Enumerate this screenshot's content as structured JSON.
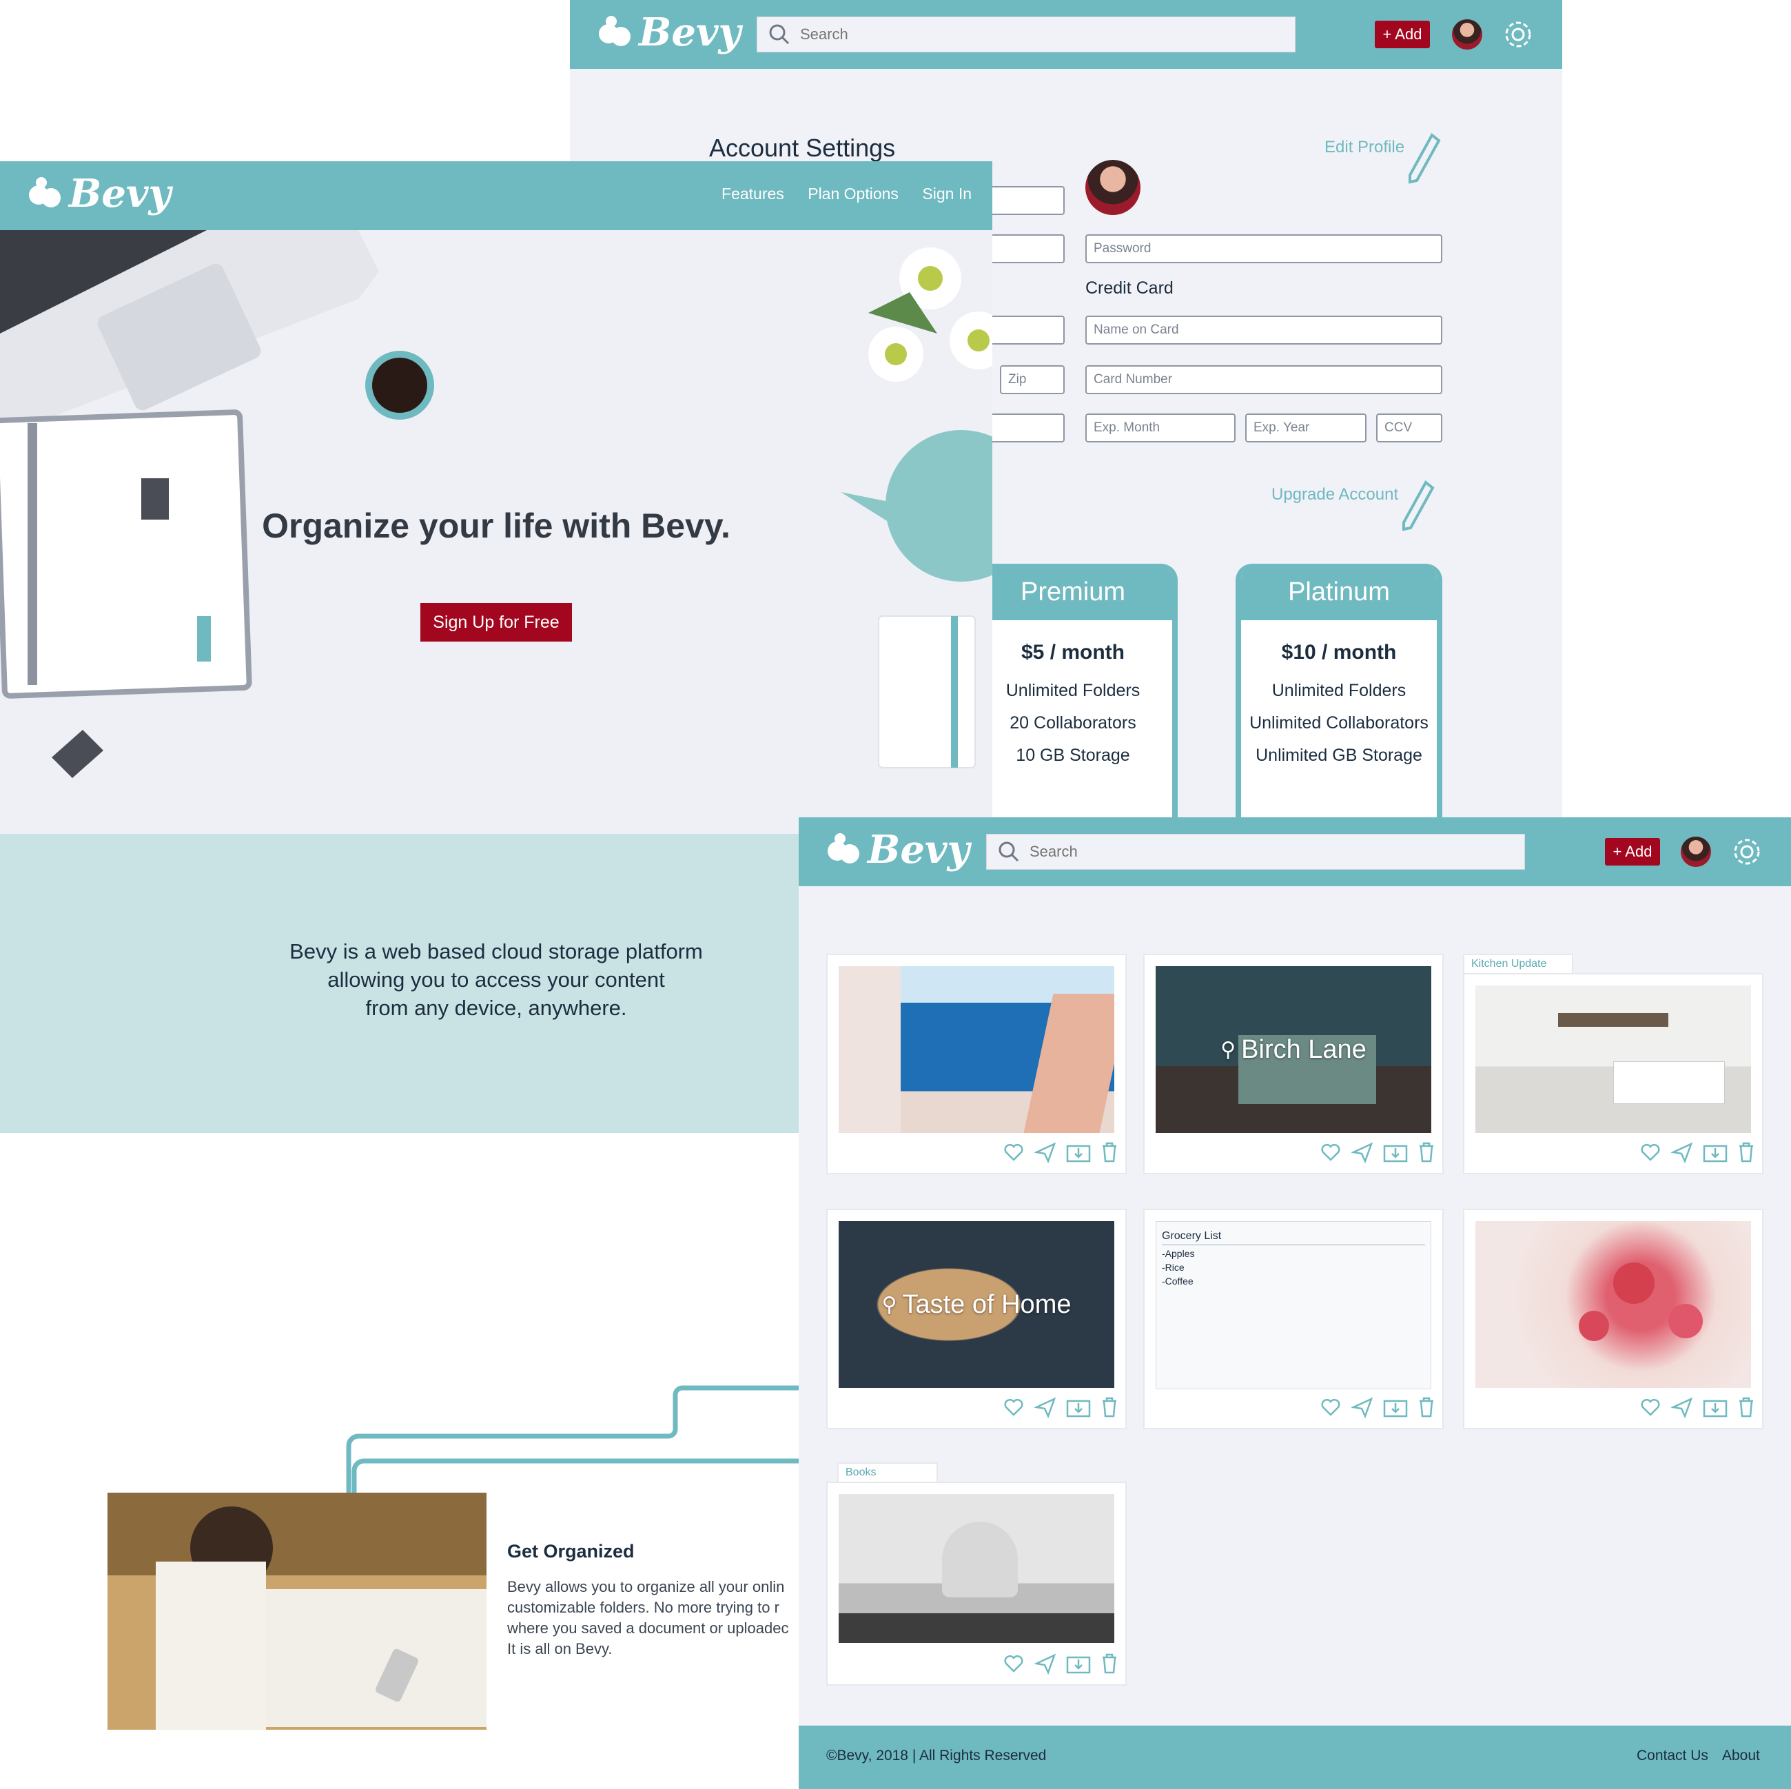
{
  "brand": {
    "name": "Bevy",
    "teal": "#6fb9c0",
    "accent": "#a3071f"
  },
  "settings_page": {
    "search_placeholder": "Search",
    "add_label": "+ Add",
    "title": "Account Settings",
    "edit_profile": "Edit Profile",
    "password_placeholder": "Password",
    "credit_card_heading": "Credit Card",
    "name_on_card_placeholder": "Name on Card",
    "zip_placeholder": "Zip",
    "card_number_placeholder": "Card Number",
    "exp_month_placeholder": "Exp. Month",
    "exp_year_placeholder": "Exp. Year",
    "ccv_placeholder": "CCV",
    "upgrade_account": "Upgrade Account",
    "plans": [
      {
        "name": "Premium",
        "price": "$5 / month",
        "features": [
          "Unlimited Folders",
          "20 Collaborators",
          "10 GB Storage"
        ]
      },
      {
        "name": "Platinum",
        "price": "$10 / month",
        "features": [
          "Unlimited Folders",
          "Unlimited Collaborators",
          "Unlimited GB Storage"
        ]
      }
    ]
  },
  "landing_page": {
    "nav": [
      "Features",
      "Plan Options",
      "Sign In"
    ],
    "hero_title": "Organize your life with Bevy.",
    "signup_label": "Sign Up for Free",
    "tagline_lines": [
      "Bevy is a web based cloud storage platform",
      "allowing you to access your content",
      "from any device, anywhere."
    ],
    "feature_title": "Get Organized",
    "feature_lines": [
      "Bevy allows you to organize all your onlin",
      "customizable folders. No more trying to r",
      "where you saved a document or uploadec",
      "It is all on Bevy."
    ]
  },
  "dashboard": {
    "search_placeholder": "Search",
    "add_label": "+ Add",
    "cards": [
      {
        "title": "",
        "tab": ""
      },
      {
        "title": "Birch Lane",
        "tab": ""
      },
      {
        "title": "",
        "tab": "Kitchen Update"
      },
      {
        "title": "Taste of Home",
        "tab": ""
      },
      {
        "title": "Grocery List",
        "tab": "",
        "note_items": [
          "-Apples",
          "-Rice",
          "-Coffee"
        ]
      },
      {
        "title": "",
        "tab": ""
      },
      {
        "title": "",
        "tab": "Books"
      }
    ],
    "card_icons": [
      "heart-icon",
      "send-icon",
      "folder-download-icon",
      "trash-icon"
    ],
    "footer_copyright": "©Bevy, 2018 | All Rights Reserved",
    "footer_links": [
      "Contact Us",
      "About"
    ]
  }
}
